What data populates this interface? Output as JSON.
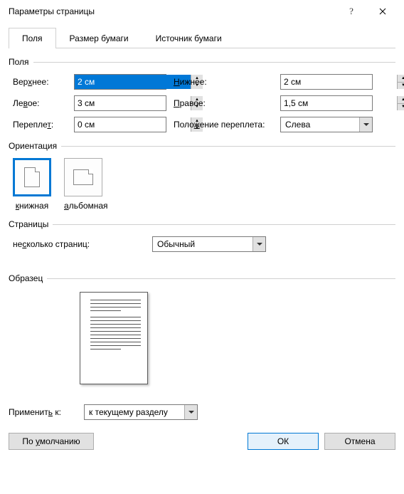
{
  "title": "Параметры страницы",
  "tabs": {
    "margins": "Поля",
    "paper": "Размер бумаги",
    "source": "Источник бумаги"
  },
  "sections": {
    "margins": "Поля",
    "orientation": "Ориентация",
    "pages": "Страницы",
    "preview": "Образец"
  },
  "labels": {
    "top_pre": "Вер",
    "top_u": "х",
    "top_post": "нее:",
    "bottom_u": "Н",
    "bottom_post": "ижнее:",
    "left_pre": "Ле",
    "left_u": "в",
    "left_post": "ое:",
    "right_u": "П",
    "right_post": "равое:",
    "gutter_pre": "Перепле",
    "gutter_u": "т",
    "gutter_post": ":",
    "gutter_pos_pre": "Поло",
    "gutter_pos_u": "ж",
    "gutter_pos_post": "ение переплета:",
    "portrait_u": "к",
    "portrait_post": "нижная",
    "landscape_u": "а",
    "landscape_post": "льбомная",
    "multi_pre": "не",
    "multi_u": "с",
    "multi_post": "колько страниц:",
    "apply_pre": "Применит",
    "apply_u": "ь",
    "apply_post": " к:",
    "default_pre": "По ",
    "default_u": "у",
    "default_post": "молчанию"
  },
  "values": {
    "top": "2 см",
    "bottom": "2 см",
    "left": "3 см",
    "right": "1,5 см",
    "gutter": "0 см",
    "gutter_pos": "Слева",
    "multi_pages": "Обычный",
    "apply_to": "к текущему разделу"
  },
  "buttons": {
    "ok": "ОК",
    "cancel": "Отмена"
  }
}
